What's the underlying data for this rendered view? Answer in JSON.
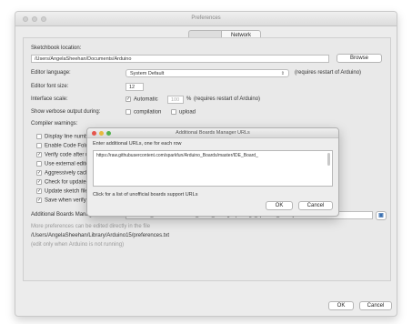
{
  "window": {
    "title": "Preferences"
  },
  "tabs": {
    "settings": "",
    "network": "Network"
  },
  "sketchbook": {
    "label": "Sketchbook location:",
    "path": "/Users/AngelaSheehan/Documents/Arduino",
    "browse": "Browse"
  },
  "language": {
    "label": "Editor language:",
    "value": "System Default",
    "note": "(requires restart of Arduino)"
  },
  "font_size": {
    "label": "Editor font size:",
    "value": "12"
  },
  "scale": {
    "label": "Interface scale:",
    "automatic": "Automatic",
    "percent": "100",
    "pct_sign": "%",
    "note": "(requires restart of Arduino)"
  },
  "verbose": {
    "label": "Show verbose output during:",
    "compilation": "compilation",
    "upload": "upload"
  },
  "compiler": {
    "label": "Compiler warnings:"
  },
  "checks": [
    {
      "label": "Display line numbers",
      "checked": false
    },
    {
      "label": "Enable Code Folding",
      "checked": false
    },
    {
      "label": "Verify code after upload",
      "checked": true
    },
    {
      "label": "Use external editor",
      "checked": false
    },
    {
      "label": "Aggressively cache compiled core",
      "checked": true
    },
    {
      "label": "Check for updates on startup",
      "checked": true
    },
    {
      "label": "Update sketch files to new extension on save (.pde -> .ino)",
      "checked": true
    },
    {
      "label": "Save when verifying or uploading",
      "checked": true
    }
  ],
  "boards": {
    "label": "Additional Boards Manager URLs:",
    "value": "n/Arduino_Boards/master/IDE_Board_Manager/package_sparkfun_index.json"
  },
  "info": {
    "more": "More preferences can be edited directly in the file",
    "path": "/Users/AngelaSheehan/Library/Arduino15/preferences.txt",
    "edit_note": "(edit only when Arduino is not running)"
  },
  "footer": {
    "ok": "OK",
    "cancel": "Cancel"
  },
  "dialog": {
    "title": "Additional Boards Manager URLs",
    "prompt": "Enter additional URLs, one for each row",
    "url": "https://raw.githubusercontent.com/sparkfun/Arduino_Boards/master/IDE_Board_",
    "link": "Click for a list of unofficial boards support URLs",
    "ok": "OK",
    "cancel": "Cancel"
  },
  "colors": {
    "close": "#e5564d",
    "minimize": "#e7b93d",
    "zoom": "#54b04f",
    "accent": "#3a6fb0"
  }
}
